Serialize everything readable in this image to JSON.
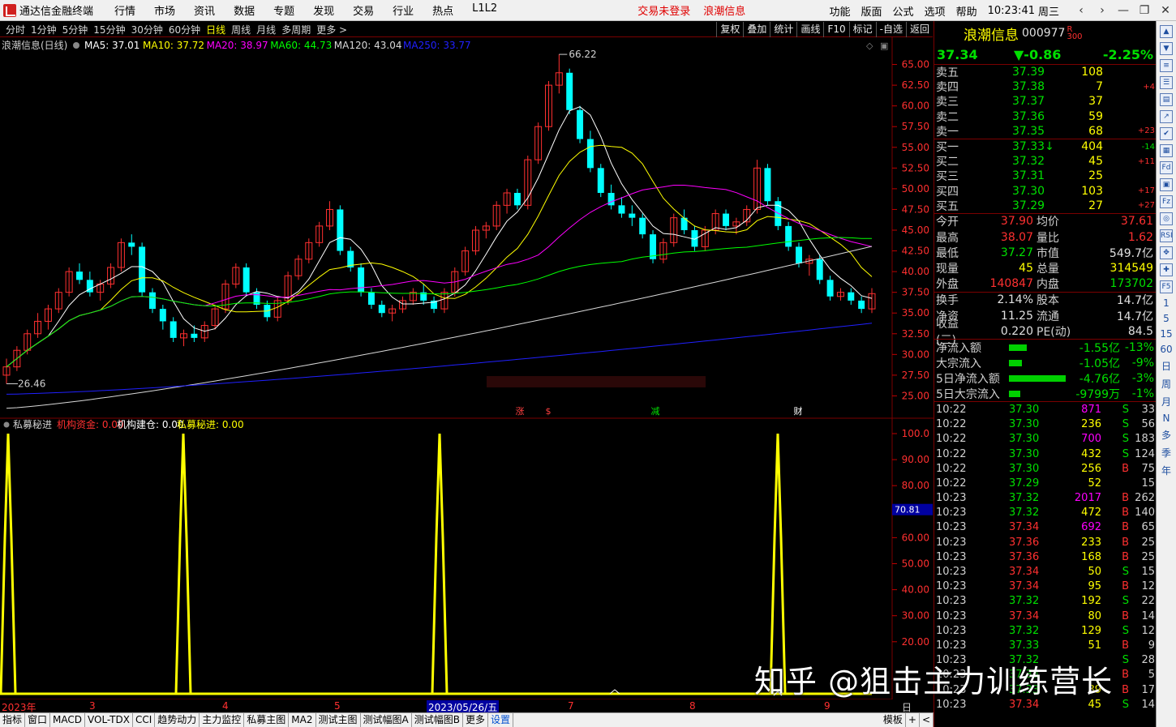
{
  "app_title": "通达信金融终端",
  "menu": [
    "行情",
    "市场",
    "资讯",
    "数据",
    "专题",
    "发现",
    "交易",
    "行业",
    "热点",
    "L1L2"
  ],
  "trade_status": "交易未登录",
  "menu_stock_name": "浪潮信息",
  "right_menu": [
    "功能",
    "版面",
    "公式",
    "选项",
    "帮助"
  ],
  "clock": "10:23:41",
  "weekday": "周三",
  "window_buttons": [
    "‹",
    "›",
    "—",
    "❐",
    "✕"
  ],
  "toolbar_periods": [
    "分时",
    "1分钟",
    "5分钟",
    "15分钟",
    "30分钟",
    "60分钟",
    "日线",
    "周线",
    "月线",
    "多周期",
    "更多 >"
  ],
  "toolbar_active": "日线",
  "toolbar_right": [
    "复权",
    "叠加",
    "统计",
    "画线",
    "F10",
    "标记",
    "-自选",
    "返回"
  ],
  "chart_header": {
    "title": "浪潮信息(日线)",
    "ma": [
      {
        "label": "MA5: 37.01",
        "color": "#ffffff"
      },
      {
        "label": "MA10: 37.72",
        "color": "#ffff00"
      },
      {
        "label": "MA20: 38.97",
        "color": "#ff00ff"
      },
      {
        "label": "MA60: 44.73",
        "color": "#00ff00"
      },
      {
        "label": "MA120: 43.04",
        "color": "#d8d8d8"
      },
      {
        "label": "MA250: 33.77",
        "color": "#2020ff"
      }
    ]
  },
  "price_axis": [
    "65.00",
    "62.50",
    "60.00",
    "57.50",
    "55.00",
    "52.50",
    "50.00",
    "47.50",
    "45.00",
    "42.50",
    "40.00",
    "37.50",
    "35.00",
    "32.50",
    "30.00",
    "27.50",
    "25.00"
  ],
  "high_label": "66.22",
  "low_label": "26.46",
  "event_marks": [
    {
      "text": "涨",
      "color": "#ff4040"
    },
    {
      "text": "$",
      "color": "#ff4040"
    },
    {
      "text": "减",
      "color": "#00e000"
    },
    {
      "text": "财",
      "color": "#ffffff"
    }
  ],
  "indicator_header": {
    "name": "私募秘进",
    "items": [
      {
        "label": "机构资金: 0.00",
        "color": "#ff3030"
      },
      {
        "label": "机构建仓: 0.00",
        "color": "#ffffff"
      },
      {
        "label": "私募秘进: 0.00",
        "color": "#ffff00"
      }
    ]
  },
  "indicator_axis": [
    "100.0",
    "90.00",
    "80.00",
    "70.00",
    "60.00",
    "50.00",
    "40.00",
    "30.00",
    "20.00"
  ],
  "indicator_cursor": "70.81",
  "date_axis": [
    "2023年",
    "3",
    "4",
    "5",
    "2023/05/26/五",
    "7",
    "8",
    "9"
  ],
  "date_axis_right": "日线",
  "side": {
    "name": "浪潮信息",
    "code": "000977",
    "flag": "R\n300",
    "price": "37.34",
    "change": "▼-0.86",
    "change_pct": "-2.25%",
    "asks": [
      {
        "label": "卖五",
        "price": "37.39",
        "vol": "108",
        "chg": ""
      },
      {
        "label": "卖四",
        "price": "37.38",
        "vol": "7",
        "chg": "+4"
      },
      {
        "label": "卖三",
        "price": "37.37",
        "vol": "37",
        "chg": ""
      },
      {
        "label": "卖二",
        "price": "37.36",
        "vol": "59",
        "chg": ""
      },
      {
        "label": "卖一",
        "price": "37.35",
        "vol": "68",
        "chg": "+23"
      }
    ],
    "bids": [
      {
        "label": "买一",
        "price": "37.33↓",
        "vol": "404",
        "chg": "-14"
      },
      {
        "label": "买二",
        "price": "37.32",
        "vol": "45",
        "chg": "+11"
      },
      {
        "label": "买三",
        "price": "37.31",
        "vol": "25",
        "chg": ""
      },
      {
        "label": "买四",
        "price": "37.30",
        "vol": "103",
        "chg": "+17"
      },
      {
        "label": "买五",
        "price": "37.29",
        "vol": "27",
        "chg": "+27"
      }
    ],
    "stats1": [
      {
        "l1": "今开",
        "v1": "37.90",
        "c1": "#ff3030",
        "l2": "均价",
        "v2": "37.61",
        "c2": "#ff3030"
      },
      {
        "l1": "最高",
        "v1": "38.07",
        "c1": "#ff3030",
        "l2": "量比",
        "v2": "1.62",
        "c2": "#ff3030"
      },
      {
        "l1": "最低",
        "v1": "37.27",
        "c1": "#00e000",
        "l2": "市值",
        "v2": "549.7亿",
        "c2": "#e0e0e0"
      },
      {
        "l1": "现量",
        "v1": "45",
        "c1": "#ffff00",
        "l2": "总量",
        "v2": "314549",
        "c2": "#ffff00"
      },
      {
        "l1": "外盘",
        "v1": "140847",
        "c1": "#ff3030",
        "l2": "内盘",
        "v2": "173702",
        "c2": "#00e000"
      }
    ],
    "stats2": [
      {
        "l1": "换手",
        "v1": "2.14%",
        "c1": "#e0e0e0",
        "l2": "股本",
        "v2": "14.7亿",
        "c2": "#e0e0e0"
      },
      {
        "l1": "净资",
        "v1": "11.25",
        "c1": "#e0e0e0",
        "l2": "流通",
        "v2": "14.7亿",
        "c2": "#e0e0e0"
      },
      {
        "l1": "收益(三)",
        "v1": "0.220",
        "c1": "#e0e0e0",
        "l2": "PE(动)",
        "v2": "84.5",
        "c2": "#e0e0e0"
      }
    ],
    "flows": [
      {
        "label": "净流入额",
        "value": "-1.55亿",
        "pct": "-13%",
        "bar": 0.14
      },
      {
        "label": "大宗流入",
        "value": "-1.05亿",
        "pct": "-9%",
        "bar": 0.1
      },
      {
        "label": "5日净流入额",
        "value": "-4.76亿",
        "pct": "-3%",
        "bar": 0.44
      },
      {
        "label": "5日大宗流入",
        "value": "-9799万",
        "pct": "-1%",
        "bar": 0.09
      }
    ],
    "ticks": [
      {
        "t": "10:22",
        "p": "37.30",
        "v": "871",
        "s": "S",
        "n": "33"
      },
      {
        "t": "10:22",
        "p": "37.30",
        "v": "236",
        "s": "S",
        "n": "56"
      },
      {
        "t": "10:22",
        "p": "37.30",
        "v": "700",
        "s": "S",
        "n": "183"
      },
      {
        "t": "10:22",
        "p": "37.30",
        "v": "432",
        "s": "S",
        "n": "124"
      },
      {
        "t": "10:22",
        "p": "37.30",
        "v": "256",
        "s": "B",
        "n": "75"
      },
      {
        "t": "10:22",
        "p": "37.29",
        "v": "52",
        "s": "",
        "n": "15"
      },
      {
        "t": "10:23",
        "p": "37.32",
        "v": "2017",
        "s": "B",
        "n": "262"
      },
      {
        "t": "10:23",
        "p": "37.32",
        "v": "472",
        "s": "B",
        "n": "140"
      },
      {
        "t": "10:23",
        "p": "37.34",
        "v": "692",
        "s": "B",
        "n": "65"
      },
      {
        "t": "10:23",
        "p": "37.36",
        "v": "233",
        "s": "B",
        "n": "25"
      },
      {
        "t": "10:23",
        "p": "37.36",
        "v": "168",
        "s": "B",
        "n": "25"
      },
      {
        "t": "10:23",
        "p": "37.34",
        "v": "50",
        "s": "S",
        "n": "15"
      },
      {
        "t": "10:23",
        "p": "37.34",
        "v": "95",
        "s": "B",
        "n": "12"
      },
      {
        "t": "10:23",
        "p": "37.32",
        "v": "192",
        "s": "S",
        "n": "22"
      },
      {
        "t": "10:23",
        "p": "37.34",
        "v": "80",
        "s": "B",
        "n": "14"
      },
      {
        "t": "10:23",
        "p": "37.32",
        "v": "129",
        "s": "S",
        "n": "12"
      },
      {
        "t": "10:23",
        "p": "37.33",
        "v": "51",
        "s": "B",
        "n": "9"
      },
      {
        "t": "10:23",
        "p": "37.32",
        "v": "",
        "s": "S",
        "n": "28"
      },
      {
        "t": "10:23",
        "p": "37.33",
        "v": "",
        "s": "B",
        "n": "5"
      },
      {
        "t": "10:23",
        "p": "37.33",
        "v": "89",
        "s": "B",
        "n": "17"
      },
      {
        "t": "10:23",
        "p": "37.34",
        "v": "45",
        "s": "S",
        "n": "14"
      }
    ]
  },
  "right_icons": [
    "▲",
    "▼",
    "≡",
    "☰",
    "▤",
    "↗",
    "✔",
    "▦",
    "Fd",
    "▣",
    "Fz",
    "◎",
    "RSI",
    "✥",
    "✚",
    "F5"
  ],
  "right_texts": [
    "1",
    "5",
    "15",
    "60",
    "日",
    "周",
    "月",
    "N",
    "多",
    "季",
    "年"
  ],
  "bottom_tabs": [
    "指标",
    "窗口",
    "MACD",
    "VOL-TDX",
    "CCI",
    "趋势动力",
    "主力监控",
    "私募主图",
    "MA2",
    "测试主图",
    "测试幅图A",
    "测试幅图B",
    "更多",
    "设置"
  ],
  "bottom_active": "设置",
  "bottom_right": [
    "模板",
    "+",
    "<"
  ],
  "watermark": "知乎 @狙击主力训练营长",
  "chart_data": {
    "type": "line",
    "title": "浪潮信息(日线)",
    "price_ylim": [
      22.5,
      67.5
    ],
    "candles_approx": [
      [
        27.5,
        29.5,
        26.46,
        28.5
      ],
      [
        28.5,
        31,
        28,
        30.5
      ],
      [
        30.5,
        33,
        30,
        32.5
      ],
      [
        32.5,
        35,
        32,
        34
      ],
      [
        34,
        36,
        33,
        35.5
      ],
      [
        35.5,
        38,
        35,
        37.5
      ],
      [
        37.5,
        40.5,
        37,
        40
      ],
      [
        40,
        41,
        38.5,
        39
      ],
      [
        39,
        40,
        37,
        37.5
      ],
      [
        37.5,
        39,
        36.5,
        38.5
      ],
      [
        38.5,
        41,
        38,
        40.5
      ],
      [
        40.5,
        44,
        40,
        43.5
      ],
      [
        43.5,
        44.5,
        42,
        43
      ],
      [
        43,
        43.5,
        37,
        37.5
      ],
      [
        37.5,
        38,
        35,
        35.5
      ],
      [
        35.5,
        36,
        33,
        34
      ],
      [
        34,
        34.5,
        31.5,
        32
      ],
      [
        32,
        33,
        31,
        32.5
      ],
      [
        32.5,
        33.5,
        31.5,
        32
      ],
      [
        32,
        34,
        31.5,
        33.5
      ],
      [
        33.5,
        36,
        33,
        35.5
      ],
      [
        35.5,
        39,
        35,
        38.5
      ],
      [
        38.5,
        41,
        38,
        40.5
      ],
      [
        40.5,
        41,
        37,
        37.5
      ],
      [
        37.5,
        38,
        35.5,
        36
      ],
      [
        36,
        36.5,
        34,
        34.5
      ],
      [
        34.5,
        37,
        34,
        36.5
      ],
      [
        36.5,
        40,
        36,
        39.5
      ],
      [
        39.5,
        42,
        39,
        41.5
      ],
      [
        41.5,
        44,
        41,
        43.5
      ],
      [
        43.5,
        46,
        43,
        45.5
      ],
      [
        45.5,
        48.5,
        45,
        47.5
      ],
      [
        47.5,
        48,
        42,
        42.5
      ],
      [
        42.5,
        43,
        40,
        40.5
      ],
      [
        40.5,
        41,
        37,
        37.5
      ],
      [
        37.5,
        38,
        35.5,
        36
      ],
      [
        36,
        36.5,
        34.5,
        35
      ],
      [
        35,
        36,
        34,
        35.5
      ],
      [
        35.5,
        37,
        35,
        36.5
      ],
      [
        36.5,
        38,
        36,
        37.5
      ],
      [
        37.5,
        38.5,
        36,
        36.5
      ],
      [
        36.5,
        37,
        35,
        35.5
      ],
      [
        35.5,
        38,
        35,
        37.5
      ],
      [
        37.5,
        40.5,
        37,
        40
      ],
      [
        40,
        43,
        39.5,
        42.5
      ],
      [
        42.5,
        45.5,
        42,
        45
      ],
      [
        45,
        46,
        44,
        45.5
      ],
      [
        45.5,
        48.5,
        45,
        48
      ],
      [
        48,
        50,
        47,
        49.5
      ],
      [
        49.5,
        50,
        47.5,
        48
      ],
      [
        48,
        54,
        47.5,
        53.5
      ],
      [
        53.5,
        58,
        53,
        57.5
      ],
      [
        57.5,
        63,
        57,
        62.5
      ],
      [
        62.5,
        66.22,
        61.5,
        64
      ],
      [
        64,
        64.5,
        59,
        59.5
      ],
      [
        59.5,
        60,
        55.5,
        56
      ],
      [
        56,
        57,
        52,
        52.5
      ],
      [
        52.5,
        53,
        49,
        49.5
      ],
      [
        49.5,
        50.5,
        47.5,
        48
      ],
      [
        48,
        49,
        46.5,
        47
      ],
      [
        47,
        48,
        45.5,
        46.5
      ],
      [
        46.5,
        47,
        44,
        44.5
      ],
      [
        44.5,
        45,
        41,
        41.5
      ],
      [
        41.5,
        44,
        41,
        43.5
      ],
      [
        43.5,
        47,
        43,
        46.5
      ],
      [
        46.5,
        47.5,
        44.5,
        45
      ],
      [
        45,
        45.5,
        42.5,
        43
      ],
      [
        43,
        45.5,
        42.5,
        45
      ],
      [
        45,
        47.5,
        44.5,
        47
      ],
      [
        47,
        47.5,
        45,
        45.5
      ],
      [
        45.5,
        46.5,
        44.5,
        46
      ],
      [
        46,
        48,
        45.5,
        47.5
      ],
      [
        47.5,
        53.5,
        47,
        52.5
      ],
      [
        52.5,
        53,
        48,
        48.5
      ],
      [
        48.5,
        49,
        45,
        45.5
      ],
      [
        45.5,
        46,
        42.5,
        43
      ],
      [
        43,
        43.5,
        40.5,
        41
      ],
      [
        41,
        42,
        39.5,
        41.5
      ],
      [
        41.5,
        42,
        38.5,
        39
      ],
      [
        39,
        39.5,
        36.5,
        37
      ],
      [
        37,
        38,
        36.5,
        37.5
      ],
      [
        37.5,
        38,
        36,
        36.5
      ],
      [
        36.5,
        37,
        35,
        35.5
      ],
      [
        35.5,
        38,
        35,
        37.34
      ]
    ],
    "ma_series": [
      {
        "name": "MA5",
        "color": "#ffffff"
      },
      {
        "name": "MA10",
        "color": "#ffff00"
      },
      {
        "name": "MA20",
        "color": "#ff00ff"
      },
      {
        "name": "MA60",
        "color": "#00ff00"
      },
      {
        "name": "MA120",
        "color": "#d8d8d8"
      },
      {
        "name": "MA250",
        "color": "#2020ff"
      }
    ],
    "indicator": {
      "name": "私募秘进",
      "ylim": [
        0,
        100
      ],
      "spikes_at_bar": [
        1,
        27,
        66,
        116
      ],
      "spike_value": 100,
      "baseline": 0
    }
  }
}
